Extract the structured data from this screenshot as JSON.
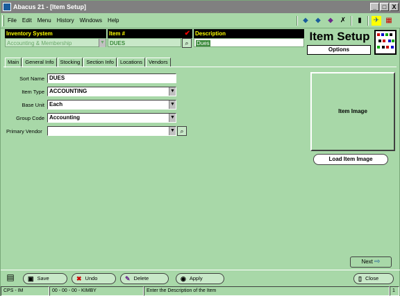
{
  "window": {
    "title": "Abacus 21 - [Item Setup]",
    "min": "_",
    "max": "□",
    "close": "X"
  },
  "menu": [
    "File",
    "Edit",
    "Menu",
    "History",
    "Windows",
    "Help"
  ],
  "header": {
    "inventory_system": {
      "label": "Inventory System",
      "value": "Accounting & Membership"
    },
    "item_no": {
      "label": "Item #",
      "value": "DUES"
    },
    "description": {
      "label": "Description",
      "value": "Dues"
    },
    "page_title": "Item Setup",
    "options_label": "Options"
  },
  "tabs": [
    "Main",
    "General Info",
    "Stocking",
    "Section Info",
    "Locations",
    "Vendors"
  ],
  "form": {
    "sort_name": {
      "label": "Sort Name",
      "value": "DUES"
    },
    "item_type": {
      "label": "Item Type",
      "value": "ACCOUNTING"
    },
    "base_unit": {
      "label": "Base Unit",
      "value": "Each"
    },
    "group_code": {
      "label": "Group Code",
      "value": "Accounting"
    },
    "primary_vendor": {
      "label": "Primary Vendor",
      "value": ""
    }
  },
  "image_panel": {
    "label": "Item Image",
    "load_label": "Load Item Image"
  },
  "next_label": "Next",
  "buttons": {
    "save": "Save",
    "undo": "Undo",
    "delete": "Delete",
    "apply": "Apply",
    "close": "Close"
  },
  "status": {
    "module": "CPS - IM",
    "session": "00 - 00 - 00 - KIMBY",
    "hint": "Enter the Description of the Item",
    "page": "1"
  },
  "colors": {
    "background": "#a8d8a8",
    "header_bg": "#000000",
    "header_text": "#ffff00"
  }
}
